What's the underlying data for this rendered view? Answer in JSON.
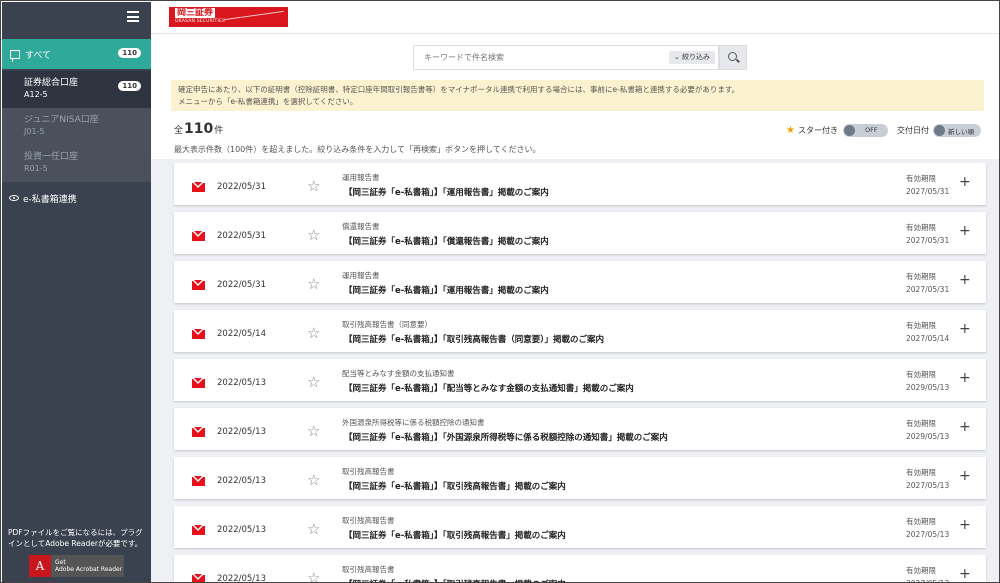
{
  "sidebar": {
    "all_label": "すべて",
    "all_count": "110",
    "accounts": [
      {
        "name": "証券総合口座",
        "code": "A12-5",
        "count": "110"
      },
      {
        "name": "ジュニアNISA口座",
        "code": "J01-5"
      },
      {
        "name": "投資一任口座",
        "code": "R01-5"
      }
    ],
    "link_label": "e-私書箱連携",
    "pdf_note": "PDFファイルをご覧になるには、プラグインとしてAdobe Readerが必要です。",
    "adobe_get": "Get",
    "adobe_name": "Adobe Acrobat Reader"
  },
  "header": {
    "brand_name": "岡三証券",
    "brand_sub": "OKASAN SECURITIES"
  },
  "search": {
    "placeholder": "キーワードで件名検索",
    "filter_label": "絞り込み"
  },
  "notice": {
    "line1": "確定申告にあたり、以下の証明書（控除証明書、特定口座年間取引報告書等）をマイナポータル連携で利用する場合には、事前にe-私書箱と連携する必要があります。",
    "line2": "メニューから「e-私書箱連携」を選択してください。"
  },
  "summary": {
    "total_prefix": "全",
    "total_count": "110",
    "total_suffix": "件",
    "overflow_msg": "最大表示件数（100件）を超えました。絞り込み条件を入力して「再検索」ボタンを押してください。",
    "star_label": "スター付き",
    "star_toggle": "OFF",
    "date_label": "交付日付",
    "date_toggle": "新しい順"
  },
  "documents": [
    {
      "date": "2022/05/31",
      "category": "運用報告書",
      "title": "【岡三証券「e-私書箱」】「運用報告書」掲載のご案内",
      "expiry_label": "有効期限",
      "expiry": "2027/05/31"
    },
    {
      "date": "2022/05/31",
      "category": "償還報告書",
      "title": "【岡三証券「e-私書箱」】「償還報告書」掲載のご案内",
      "expiry_label": "有効期限",
      "expiry": "2027/05/31"
    },
    {
      "date": "2022/05/31",
      "category": "運用報告書",
      "title": "【岡三証券「e-私書箱」】「運用報告書」掲載のご案内",
      "expiry_label": "有効期限",
      "expiry": "2027/05/31"
    },
    {
      "date": "2022/05/14",
      "category": "取引残高報告書（同意要）",
      "title": "【岡三証券「e-私書箱」】「取引残高報告書（同意要）」掲載のご案内",
      "expiry_label": "有効期限",
      "expiry": "2027/05/14"
    },
    {
      "date": "2022/05/13",
      "category": "配当等とみなす金額の支払通知書",
      "title": "【岡三証券「e-私書箱」】「配当等とみなす金額の支払通知書」掲載のご案内",
      "expiry_label": "有効期限",
      "expiry": "2029/05/13"
    },
    {
      "date": "2022/05/13",
      "category": "外国源泉所得税等に係る税額控除の通知書",
      "title": "【岡三証券「e-私書箱」】「外国源泉所得税等に係る税額控除の通知書」掲載のご案内",
      "expiry_label": "有効期限",
      "expiry": "2029/05/13"
    },
    {
      "date": "2022/05/13",
      "category": "取引残高報告書",
      "title": "【岡三証券「e-私書箱」】「取引残高報告書」掲載のご案内",
      "expiry_label": "有効期限",
      "expiry": "2027/05/13"
    },
    {
      "date": "2022/05/13",
      "category": "取引残高報告書",
      "title": "【岡三証券「e-私書箱」】「取引残高報告書」掲載のご案内",
      "expiry_label": "有効期限",
      "expiry": "2027/05/13"
    },
    {
      "date": "2022/05/13",
      "category": "取引残高報告書",
      "title": "【岡三証券「e-私書箱」】「取引残高報告書」掲載のご案内",
      "expiry_label": "有効期限",
      "expiry": "2027/05/13"
    }
  ],
  "icons": {
    "row_icon": "mail-icon",
    "star_icon": "star-outline-icon",
    "expand_icon": "plus-icon",
    "accent": "#2fa99a",
    "brand_red": "#d9161d"
  }
}
